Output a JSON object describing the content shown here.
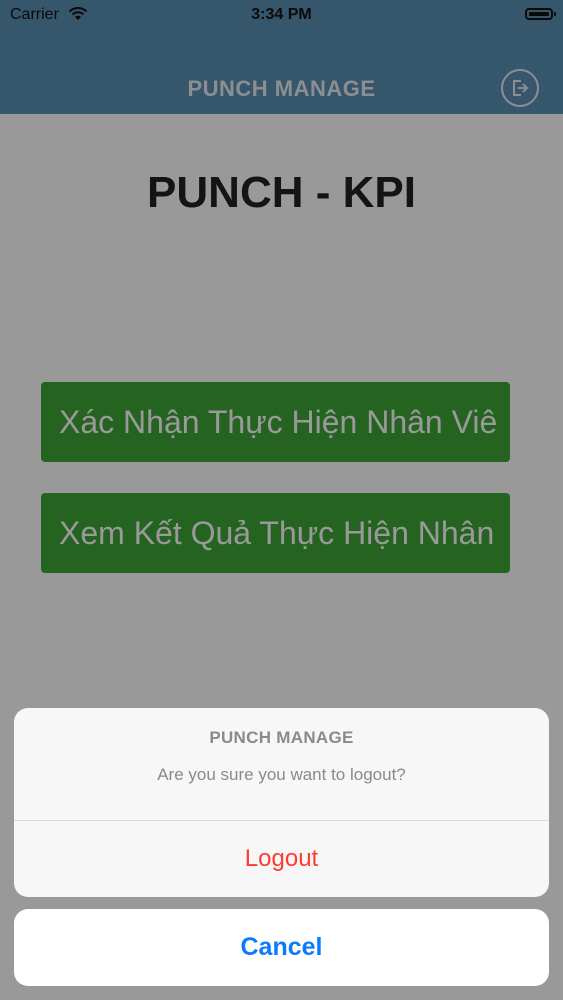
{
  "status_bar": {
    "carrier": "Carrier",
    "time": "3:34 PM"
  },
  "nav": {
    "title": "PUNCH MANAGE",
    "logout_icon": "logout-icon"
  },
  "main": {
    "title": "PUNCH - KPI",
    "buttons": [
      {
        "label": "Xác Nhận Thực Hiện Nhân Viê"
      },
      {
        "label": "Xem Kết Quả Thực Hiện Nhân"
      }
    ]
  },
  "action_sheet": {
    "title": "PUNCH MANAGE",
    "message": "Are you sure you want to logout?",
    "logout_label": "Logout",
    "cancel_label": "Cancel"
  },
  "colors": {
    "nav_background": "#5b8fb4",
    "button_green": "#3da536",
    "destructive": "#ff3b30",
    "cancel_blue": "#0a7aff"
  }
}
